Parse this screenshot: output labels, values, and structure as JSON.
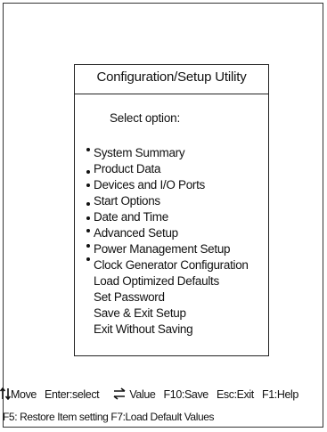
{
  "dialog": {
    "title": "Configuration/Setup Utility",
    "prompt": "Select option:"
  },
  "menu": {
    "items": [
      {
        "label": "System Summary",
        "bullet": true
      },
      {
        "label": "Product Data",
        "bullet": true
      },
      {
        "label": "Devices and I/O Ports",
        "bullet": true
      },
      {
        "label": "Start Options",
        "bullet": true
      },
      {
        "label": "Date and Time",
        "bullet": true
      },
      {
        "label": "Advanced Setup",
        "bullet": true
      },
      {
        "label": "Power Management Setup",
        "bullet": true
      },
      {
        "label": "Clock Generator Configuration",
        "bullet": true
      },
      {
        "label": "Load Optimized Defaults",
        "bullet": false
      },
      {
        "label": "Set Password",
        "bullet": false
      },
      {
        "label": "Save & Exit Setup",
        "bullet": false
      },
      {
        "label": "Exit Without Saving",
        "bullet": false
      }
    ]
  },
  "status_bar": {
    "move_label": "Move",
    "select_label": "Enter:select",
    "value_label": "Value",
    "save_label": "F10:Save",
    "exit_label": "Esc:Exit",
    "help_label": "F1:Help",
    "restore_label": "F5: Restore Item setting",
    "load_defaults_label": "F7:Load Default Values",
    "icons": {
      "move": "up-down-arrows-icon",
      "value": "left-right-arrows-icon"
    }
  }
}
